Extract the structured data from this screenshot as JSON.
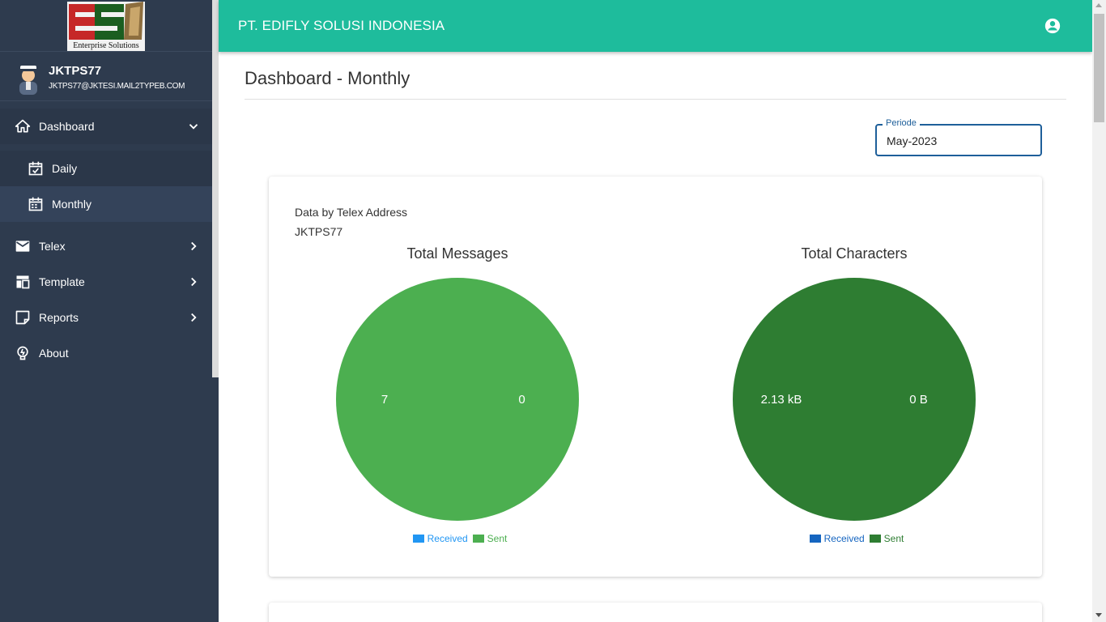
{
  "app": {
    "company_name": "PT. EDIFLY SOLUSI INDONESIA",
    "logo_text": "ESI",
    "logo_caption": "Enterprise Solutions"
  },
  "user": {
    "name": "JKTPS77",
    "email": "JKTPS77@JKTESI.MAIL2TYPEB.COM"
  },
  "sidebar": {
    "items": [
      {
        "label": "Dashboard",
        "icon": "home-icon",
        "expanded": true
      },
      {
        "label": "Daily",
        "icon": "calendar-check-icon"
      },
      {
        "label": "Monthly",
        "icon": "calendar-icon",
        "active": true
      },
      {
        "label": "Telex",
        "icon": "mail-icon"
      },
      {
        "label": "Template",
        "icon": "layout-icon"
      },
      {
        "label": "Reports",
        "icon": "note-icon"
      },
      {
        "label": "About",
        "icon": "lightbulb-icon"
      }
    ]
  },
  "page": {
    "title": "Dashboard - Monthly",
    "periode_label": "Periode",
    "periode_value": "May-2023"
  },
  "card": {
    "heading": "Data by Telex Address",
    "subheading": "JKTPS77"
  },
  "colors": {
    "header": "#1ebc9c",
    "sidebar": "#2e3b4e",
    "chart1_received": "#2196f3",
    "chart1_sent": "#4caf50",
    "chart2_received": "#1565c0",
    "chart2_sent": "#2e7d32"
  },
  "chart_data": [
    {
      "type": "pie",
      "title": "Total Messages",
      "categories": [
        "Received",
        "Sent"
      ],
      "values": [
        0,
        7
      ],
      "labels": [
        "0",
        "7"
      ],
      "colors": [
        "#2196f3",
        "#4caf50"
      ],
      "legend": "bottom"
    },
    {
      "type": "pie",
      "title": "Total Characters",
      "categories": [
        "Received",
        "Sent"
      ],
      "values": [
        0,
        2130
      ],
      "labels": [
        "0 B",
        "2.13 kB"
      ],
      "colors": [
        "#1565c0",
        "#2e7d32"
      ],
      "legend": "bottom"
    }
  ]
}
